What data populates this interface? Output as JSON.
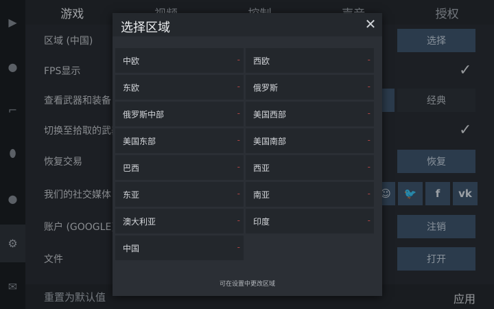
{
  "tabs": [
    {
      "label": "游戏"
    },
    {
      "label": "视频"
    },
    {
      "label": "控制"
    },
    {
      "label": "声音"
    },
    {
      "label": "授权"
    }
  ],
  "rail": [
    {
      "icon": "play-icon",
      "glyph": "▶"
    },
    {
      "icon": "user-icon",
      "glyph": "●"
    },
    {
      "icon": "gun-icon",
      "glyph": "⌐"
    },
    {
      "icon": "grenade-icon",
      "glyph": "⬮"
    },
    {
      "icon": "team-icon",
      "glyph": "●"
    },
    {
      "icon": "gear-icon",
      "glyph": "⚙"
    },
    {
      "icon": "mail-icon",
      "glyph": "✉"
    }
  ],
  "settings": {
    "rows": [
      {
        "label": "区域 (中国)",
        "button": "选择"
      },
      {
        "label": "FPS显示"
      },
      {
        "label": "查看武器和装备",
        "button": "经典"
      },
      {
        "label": "切换至拾取的武器"
      },
      {
        "label": "恢复交易",
        "button": "恢复"
      },
      {
        "label": "我们的社交媒体"
      },
      {
        "label": "账户 (GOOGLE)",
        "button": "注销"
      },
      {
        "label": "文件",
        "button": "打开"
      }
    ],
    "reset_label": "重置为默认值",
    "apply_label": "应用",
    "social": [
      {
        "icon": "discord-icon",
        "glyph": "☺"
      },
      {
        "icon": "twitter-icon",
        "glyph": "🐦"
      },
      {
        "icon": "facebook-icon",
        "glyph": "f"
      },
      {
        "icon": "vk-icon",
        "glyph": "vk"
      }
    ]
  },
  "modal": {
    "title": "选择区域",
    "close_glyph": "✕",
    "regions": [
      {
        "name": "中欧",
        "status": "-"
      },
      {
        "name": "西欧",
        "status": "-"
      },
      {
        "name": "东欧",
        "status": "-"
      },
      {
        "name": "俄罗斯",
        "status": "-"
      },
      {
        "name": "俄罗斯中部",
        "status": "-"
      },
      {
        "name": "美国西部",
        "status": "-"
      },
      {
        "name": "美国东部",
        "status": "-"
      },
      {
        "name": "美国南部",
        "status": "-"
      },
      {
        "name": "巴西",
        "status": "-"
      },
      {
        "name": "西亚",
        "status": "-"
      },
      {
        "name": "东亚",
        "status": "-"
      },
      {
        "name": "南亚",
        "status": "-"
      },
      {
        "name": "澳大利亚",
        "status": "-"
      },
      {
        "name": "印度",
        "status": "-"
      },
      {
        "name": "中国",
        "status": "-"
      }
    ],
    "footer": "可在设置中更改区域"
  },
  "colors": {
    "accent_button": "#3a4f66",
    "ping_dash": "#b04444"
  }
}
